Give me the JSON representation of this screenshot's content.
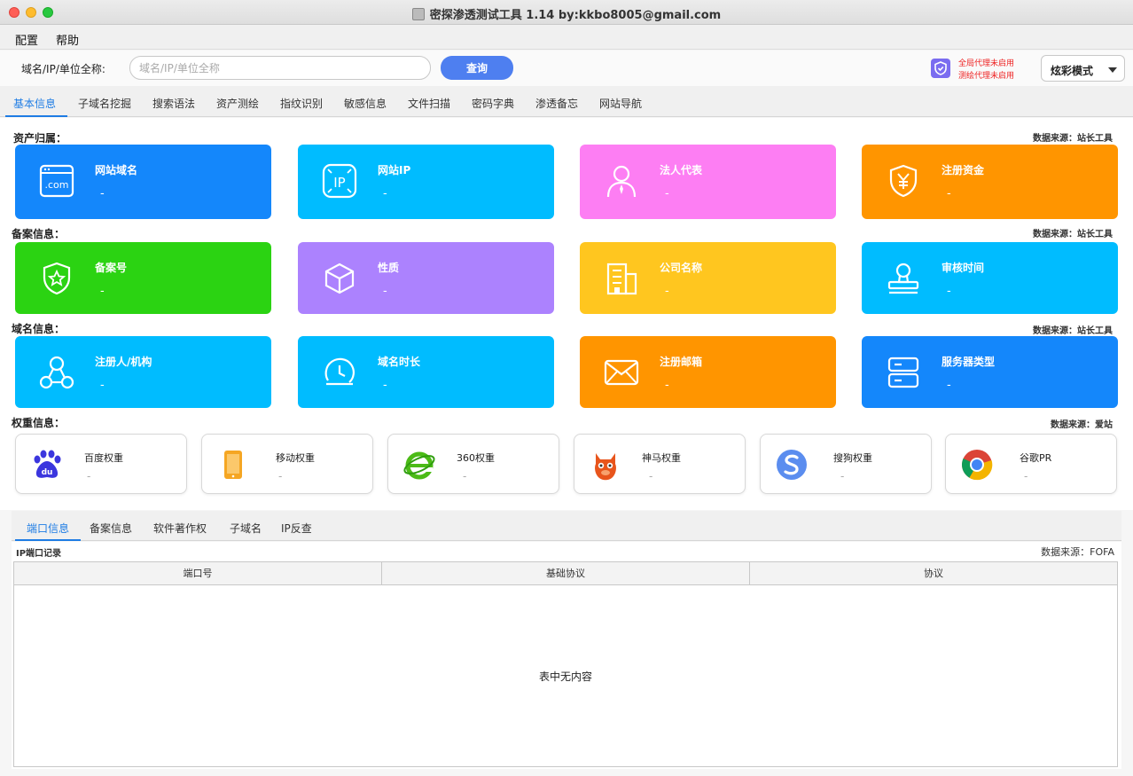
{
  "window": {
    "title": "密探渗透测试工具 1.14 by:kkbo8005@gmail.com"
  },
  "menu": [
    {
      "label": "配置"
    },
    {
      "label": "帮助"
    }
  ],
  "search": {
    "label": "域名/IP/单位全称:",
    "placeholder": "域名/IP/单位全称",
    "value": "",
    "query_label": "查询"
  },
  "proxy": {
    "global": "全局代理未启用",
    "mapping": "测绘代理未启用"
  },
  "mode": {
    "selected": "炫彩模式"
  },
  "tabs": [
    {
      "label": "基本信息",
      "active": true
    },
    {
      "label": "子域名挖掘"
    },
    {
      "label": "搜索语法"
    },
    {
      "label": "资产测绘"
    },
    {
      "label": "指纹识别"
    },
    {
      "label": "敏感信息"
    },
    {
      "label": "文件扫描"
    },
    {
      "label": "密码字典"
    },
    {
      "label": "渗透备忘"
    },
    {
      "label": "网站导航"
    }
  ],
  "sections": {
    "asset": {
      "label": "资产归属：",
      "source": "数据来源：站长工具",
      "cards": [
        {
          "title": "网站域名",
          "value": "-",
          "color": "#1487fb",
          "icon": "dotcom-icon"
        },
        {
          "title": "网站IP",
          "value": "-",
          "color": "#00bcff",
          "icon": "ip-icon"
        },
        {
          "title": "法人代表",
          "value": "-",
          "color": "#fd7ef3",
          "icon": "person-icon"
        },
        {
          "title": "注册资金",
          "value": "-",
          "color": "#ff9500",
          "icon": "yuan-shield-icon"
        }
      ]
    },
    "icp": {
      "label": "备案信息：",
      "source": "数据来源：站长工具",
      "cards": [
        {
          "title": "备案号",
          "value": "-",
          "color": "#2bd312",
          "icon": "star-shield-icon"
        },
        {
          "title": "性质",
          "value": "-",
          "color": "#ac82fe",
          "icon": "cube-icon"
        },
        {
          "title": "公司名称",
          "value": "-",
          "color": "#ffc61f",
          "icon": "building-icon"
        },
        {
          "title": "审核时间",
          "value": "-",
          "color": "#00bcff",
          "icon": "stamp-icon"
        }
      ]
    },
    "domain": {
      "label": "域名信息：",
      "source": "数据来源：站长工具",
      "cards": [
        {
          "title": "注册人/机构",
          "value": "-",
          "color": "#00bcff",
          "icon": "network-icon"
        },
        {
          "title": "域名时长",
          "value": "-",
          "color": "#00bcff",
          "icon": "clock-icon"
        },
        {
          "title": "注册邮箱",
          "value": "-",
          "color": "#ff9500",
          "icon": "mail-icon"
        },
        {
          "title": "服务器类型",
          "value": "-",
          "color": "#1487fb",
          "icon": "server-icon"
        }
      ]
    },
    "weight": {
      "label": "权重信息：",
      "source": "数据来源：爱站",
      "cards": [
        {
          "title": "百度权重",
          "value": "-",
          "icon": "baidu-icon"
        },
        {
          "title": "移动权重",
          "value": "-",
          "icon": "mobile-icon"
        },
        {
          "title": "360权重",
          "value": "-",
          "icon": "ie-360-icon"
        },
        {
          "title": "神马权重",
          "value": "-",
          "icon": "shenma-icon"
        },
        {
          "title": "搜狗权重",
          "value": "-",
          "icon": "sogou-icon"
        },
        {
          "title": "谷歌PR",
          "value": "-",
          "icon": "chrome-icon"
        }
      ]
    }
  },
  "subtabs": [
    {
      "label": "端口信息",
      "active": true
    },
    {
      "label": "备案信息"
    },
    {
      "label": "软件著作权"
    },
    {
      "label": "子域名"
    },
    {
      "label": "IP反查"
    }
  ],
  "ports": {
    "label": "IP端口记录",
    "source": "数据来源：FOFA",
    "columns": [
      "端口号",
      "基础协议",
      "协议"
    ],
    "empty": "表中无内容"
  }
}
